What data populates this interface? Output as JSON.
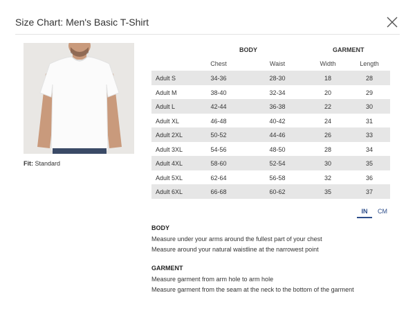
{
  "modal": {
    "title": "Size Chart: Men's Basic T-Shirt",
    "close_icon": "close-icon"
  },
  "product": {
    "image_icon": "tshirt-model-photo",
    "fit_label": "Fit:",
    "fit_value": "Standard"
  },
  "table": {
    "groups": [
      "BODY",
      "GARMENT"
    ],
    "columns": [
      "Chest",
      "Waist",
      "Width",
      "Length"
    ],
    "rows": [
      {
        "size": "Adult S",
        "chest": "34-36",
        "waist": "28-30",
        "width": "18",
        "length": "28"
      },
      {
        "size": "Adult M",
        "chest": "38-40",
        "waist": "32-34",
        "width": "20",
        "length": "29"
      },
      {
        "size": "Adult L",
        "chest": "42-44",
        "waist": "36-38",
        "width": "22",
        "length": "30"
      },
      {
        "size": "Adult XL",
        "chest": "46-48",
        "waist": "40-42",
        "width": "24",
        "length": "31"
      },
      {
        "size": "Adult 2XL",
        "chest": "50-52",
        "waist": "44-46",
        "width": "26",
        "length": "33"
      },
      {
        "size": "Adult 3XL",
        "chest": "54-56",
        "waist": "48-50",
        "width": "28",
        "length": "34"
      },
      {
        "size": "Adult 4XL",
        "chest": "58-60",
        "waist": "52-54",
        "width": "30",
        "length": "35"
      },
      {
        "size": "Adult 5XL",
        "chest": "62-64",
        "waist": "56-58",
        "width": "32",
        "length": "36"
      },
      {
        "size": "Adult 6XL",
        "chest": "66-68",
        "waist": "60-62",
        "width": "35",
        "length": "37"
      }
    ]
  },
  "units": {
    "in_label": "IN",
    "cm_label": "CM",
    "selected": "IN",
    "accent": "#2d4d8a"
  },
  "instructions": {
    "body_heading": "BODY",
    "body_lines": [
      "Measure under your arms around the fullest part of your chest",
      "Measure around your natural waistline at the narrowest point"
    ],
    "garment_heading": "GARMENT",
    "garment_lines": [
      "Measure garment from arm hole to arm hole",
      "Measure garment from the seam at the neck to the bottom of the garment"
    ]
  }
}
